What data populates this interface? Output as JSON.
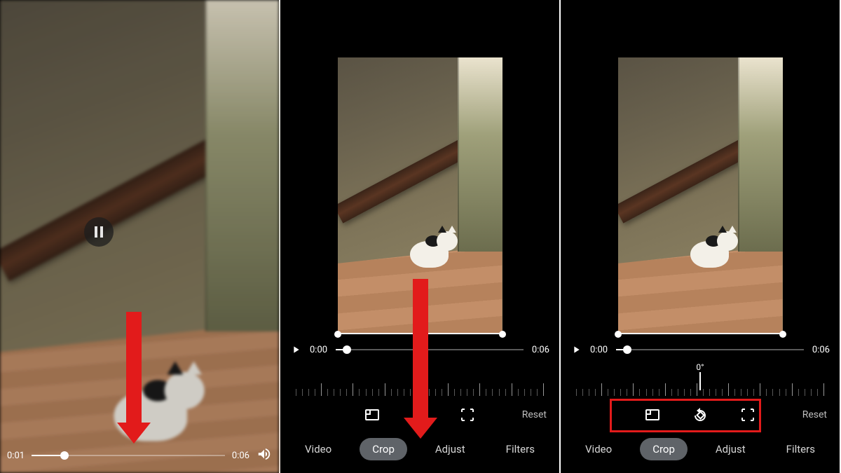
{
  "panel1": {
    "current_time": "0:01",
    "total_time": "0:06",
    "progress_pct": 17
  },
  "panel2": {
    "current_time": "0:00",
    "total_time": "0:06",
    "progress_pct": 6,
    "angle_label": "",
    "tools_reset": "Reset",
    "tabs": {
      "video": "Video",
      "crop": "Crop",
      "adjust": "Adjust",
      "filters": "Filters"
    }
  },
  "panel3": {
    "current_time": "0:00",
    "total_time": "0:06",
    "progress_pct": 6,
    "angle_label": "0°",
    "tools_reset": "Reset",
    "tabs": {
      "video": "Video",
      "crop": "Crop",
      "adjust": "Adjust",
      "filters": "Filters"
    }
  }
}
